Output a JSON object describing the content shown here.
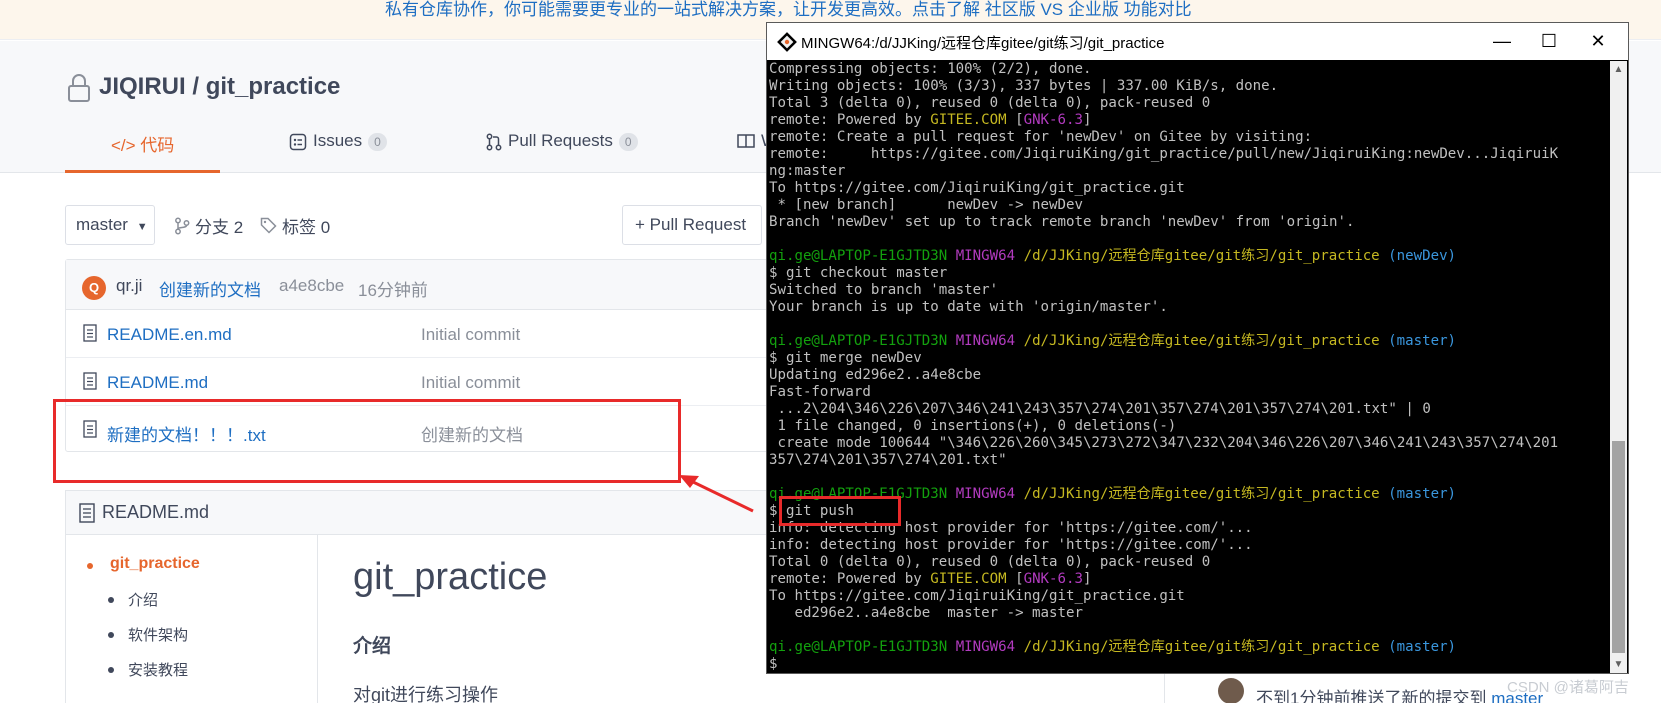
{
  "banner": {
    "text": "私有仓库协作，你可能需要更专业的一站式解决方案，让开发更高效。点击了解 社区版 VS 企业版 功能对比"
  },
  "repo": {
    "title": "JIQIRUI / git_practice",
    "tabs": [
      {
        "label": "</> 代码",
        "active": true
      },
      {
        "label": "Issues",
        "count": "0"
      },
      {
        "label": "Pull Requests",
        "count": "0"
      },
      {
        "label": "W"
      }
    ]
  },
  "toolbar": {
    "branch": "master",
    "branches": "分支 2",
    "tags": "标签 0",
    "pull_request": "+ Pull Request"
  },
  "commit": {
    "avatar": "Q",
    "author": "qr.ji",
    "message": "创建新的文档",
    "hash": "a4e8cbe",
    "time": "16分钟前"
  },
  "files": [
    {
      "name": "README.en.md",
      "commit": "Initial commit"
    },
    {
      "name": "README.md",
      "commit": "Initial commit"
    },
    {
      "name": "新建的文档！！！.txt",
      "commit": "创建新的文档"
    }
  ],
  "readme": {
    "header": "README.md",
    "toc": [
      "git_practice",
      "介绍",
      "软件架构",
      "安装教程"
    ],
    "h1": "git_practice",
    "h2": "介绍",
    "paragraph": "对git进行练习操作"
  },
  "push_note": {
    "text": "不到1分钟前推送了新的提交到",
    "branch": "master"
  },
  "watermark": "CSDN @诸葛阿吉",
  "terminal": {
    "title": "MINGW64:/d/JJKing/远程仓库gitee/git练习/git_practice",
    "buttons": {
      "minimize": "—",
      "maximize": "☐",
      "close": "✕"
    },
    "lines": [
      [
        [
          "Compressing objects: 100% (2/2), done.",
          ""
        ]
      ],
      [
        [
          "Writing objects: 100% (3/3), 337 bytes | 337.00 KiB/s, done.",
          ""
        ]
      ],
      [
        [
          "Total 3 (delta 0), reused 0 (delta 0), pack-reused 0",
          ""
        ]
      ],
      [
        [
          "remote: Powered by ",
          ""
        ],
        [
          "GITEE.COM",
          "y"
        ],
        [
          " [",
          ""
        ],
        [
          "GNK-6.3",
          "m"
        ],
        [
          "]",
          ""
        ]
      ],
      [
        [
          "remote: Create a pull request for 'newDev' on Gitee by visiting:",
          ""
        ]
      ],
      [
        [
          "remote:     https://gitee.com/JiqiruiKing/git_practice/pull/new/JiqiruiKing:newDev...JiqiruiK",
          ""
        ]
      ],
      [
        [
          "ng:master",
          ""
        ]
      ],
      [
        [
          "To https://gitee.com/JiqiruiKing/git_practice.git",
          ""
        ]
      ],
      [
        [
          " * [new branch]      newDev -> newDev",
          ""
        ]
      ],
      [
        [
          "Branch 'newDev' set up to track remote branch 'newDev' from 'origin'.",
          ""
        ]
      ],
      [
        [
          "",
          ""
        ]
      ],
      [
        [
          "qi.ge@LAPTOP-E1GJTD3N ",
          "g"
        ],
        [
          "MINGW64 ",
          "m"
        ],
        [
          "/d/JJKing/远程仓库gitee/git练习/git_practice ",
          "y"
        ],
        [
          "(newDev)",
          "c"
        ]
      ],
      [
        [
          "$ git checkout master",
          ""
        ]
      ],
      [
        [
          "Switched to branch 'master'",
          ""
        ]
      ],
      [
        [
          "Your branch is up to date with 'origin/master'.",
          ""
        ]
      ],
      [
        [
          "",
          ""
        ]
      ],
      [
        [
          "qi.ge@LAPTOP-E1GJTD3N ",
          "g"
        ],
        [
          "MINGW64 ",
          "m"
        ],
        [
          "/d/JJKing/远程仓库gitee/git练习/git_practice ",
          "y"
        ],
        [
          "(master)",
          "c"
        ]
      ],
      [
        [
          "$ git merge newDev",
          ""
        ]
      ],
      [
        [
          "Updating ed296e2..a4e8cbe",
          ""
        ]
      ],
      [
        [
          "Fast-forward",
          ""
        ]
      ],
      [
        [
          " ...2\\204\\346\\226\\207\\346\\241\\243\\357\\274\\201\\357\\274\\201\\357\\274\\201.txt\" | 0",
          ""
        ]
      ],
      [
        [
          " 1 file changed, 0 insertions(+), 0 deletions(-)",
          ""
        ]
      ],
      [
        [
          " create mode 100644 \"\\346\\226\\260\\345\\273\\272\\347\\232\\204\\346\\226\\207\\346\\241\\243\\357\\274\\201",
          ""
        ]
      ],
      [
        [
          "357\\274\\201\\357\\274\\201.txt\"",
          ""
        ]
      ],
      [
        [
          "",
          ""
        ]
      ],
      [
        [
          "qi.ge@LAPTOP-E1GJTD3N ",
          "g"
        ],
        [
          "MINGW64 ",
          "m"
        ],
        [
          "/d/JJKing/远程仓库gitee/git练习/git_practice ",
          "y"
        ],
        [
          "(master)",
          "c"
        ]
      ],
      [
        [
          "$ git push",
          ""
        ]
      ],
      [
        [
          "info: detecting host provider for 'https://gitee.com/'...",
          ""
        ]
      ],
      [
        [
          "info: detecting host provider for 'https://gitee.com/'...",
          ""
        ]
      ],
      [
        [
          "Total 0 (delta 0), reused 0 (delta 0), pack-reused 0",
          ""
        ]
      ],
      [
        [
          "remote: Powered by ",
          ""
        ],
        [
          "GITEE.COM",
          "y"
        ],
        [
          " [",
          ""
        ],
        [
          "GNK-6.3",
          "m"
        ],
        [
          "]",
          ""
        ]
      ],
      [
        [
          "To https://gitee.com/JiqiruiKing/git_practice.git",
          ""
        ]
      ],
      [
        [
          "   ed296e2..a4e8cbe  master -> master",
          ""
        ]
      ],
      [
        [
          "",
          ""
        ]
      ],
      [
        [
          "qi.ge@LAPTOP-E1GJTD3N ",
          "g"
        ],
        [
          "MINGW64 ",
          "m"
        ],
        [
          "/d/JJKing/远程仓库gitee/git练习/git_practice ",
          "y"
        ],
        [
          "(master)",
          "c"
        ]
      ],
      [
        [
          "$",
          ""
        ]
      ]
    ]
  }
}
